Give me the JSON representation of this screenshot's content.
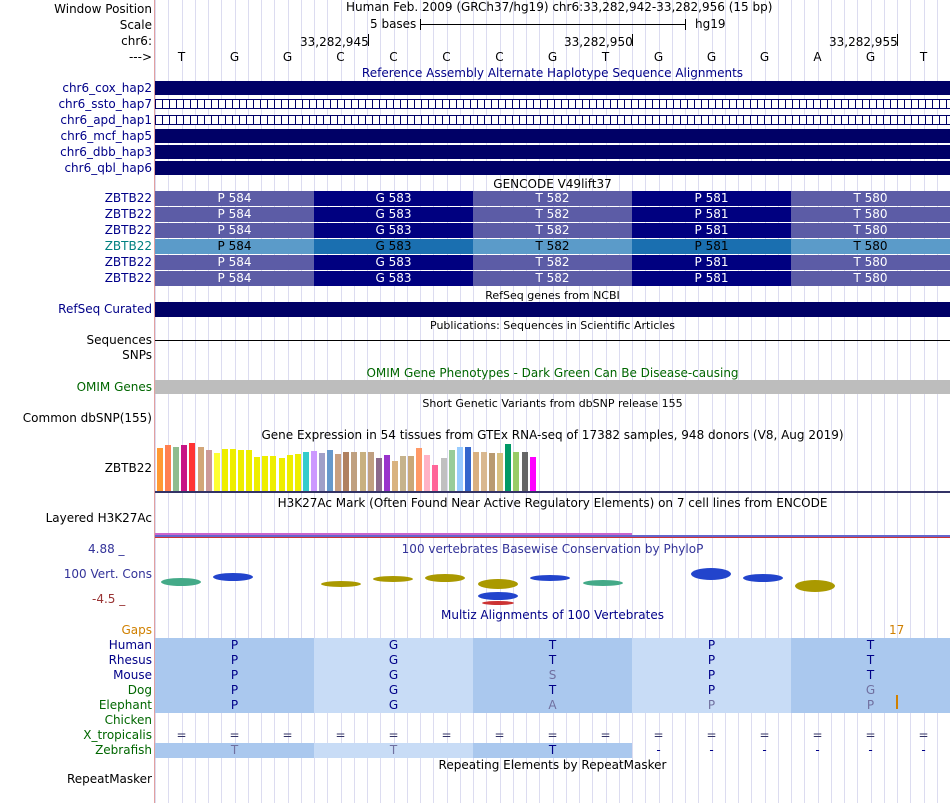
{
  "header": {
    "window_position_label": "Window Position",
    "scale_label": "Scale",
    "chrom_label": "chr6:",
    "arrow_label": "--->",
    "position_text": "Human Feb. 2009 (GRCh37/hg19)   chr6:33,282,942-33,282,956 (15 bp)",
    "scale_text": "5 bases",
    "assembly_text": "hg19",
    "coords": [
      "33,282,945",
      "33,282,950",
      "33,282,955"
    ],
    "bases": [
      "T",
      "G",
      "G",
      "C",
      "C",
      "C",
      "C",
      "G",
      "T",
      "G",
      "G",
      "G",
      "A",
      "G",
      "T"
    ]
  },
  "alt_haplotypes": {
    "title": "Reference Assembly Alternate Haplotype Sequence Alignments",
    "rows": [
      "chr6_cox_hap2",
      "chr6_ssto_hap7",
      "chr6_apd_hap1",
      "chr6_mcf_hap5",
      "chr6_dbb_hap3",
      "chr6_qbl_hap6"
    ]
  },
  "gencode": {
    "title": "GENCODE V49lift37",
    "gene": "ZBTB22",
    "codons": [
      "P 584",
      "G 583",
      "T 582",
      "P 581",
      "T 580"
    ]
  },
  "refseq": {
    "title": "RefSeq genes from NCBI",
    "label": "RefSeq Curated"
  },
  "publications": {
    "title": "Publications: Sequences in Scientific Articles",
    "label": "Sequences"
  },
  "snps": {
    "label": "SNPs"
  },
  "omim": {
    "title": "OMIM Gene Phenotypes - Dark Green Can Be Disease-causing",
    "label": "OMIM Genes"
  },
  "dbsnp": {
    "title": "Short Genetic Variants from dbSNP release 155",
    "label": "Common dbSNP(155)"
  },
  "gtex": {
    "title": "Gene Expression in 54 tissues from GTEx RNA-seq of 17382 samples, 948 donors (V8, Aug 2019)",
    "label": "ZBTB22",
    "bars": [
      {
        "c": "#ff9933",
        "h": 0.9
      },
      {
        "c": "#ff7f50",
        "h": 0.95
      },
      {
        "c": "#8fbc8f",
        "h": 0.92
      },
      {
        "c": "#c71585",
        "h": 0.95
      },
      {
        "c": "#ff3333",
        "h": 1.0
      },
      {
        "c": "#d2a679",
        "h": 0.92
      },
      {
        "c": "#cc9999",
        "h": 0.85
      },
      {
        "c": "#ffff33",
        "h": 0.8
      },
      {
        "c": "#eeee00",
        "h": 0.88
      },
      {
        "c": "#eeee00",
        "h": 0.88
      },
      {
        "c": "#eeee00",
        "h": 0.86
      },
      {
        "c": "#eeee00",
        "h": 0.85
      },
      {
        "c": "#eeee00",
        "h": 0.7
      },
      {
        "c": "#eeee00",
        "h": 0.72
      },
      {
        "c": "#eeee00",
        "h": 0.72
      },
      {
        "c": "#eeee00",
        "h": 0.68
      },
      {
        "c": "#eeee00",
        "h": 0.75
      },
      {
        "c": "#eeee00",
        "h": 0.78
      },
      {
        "c": "#33cccc",
        "h": 0.82
      },
      {
        "c": "#cc99ff",
        "h": 0.84
      },
      {
        "c": "#a0a0c8",
        "h": 0.8
      },
      {
        "c": "#6699cc",
        "h": 0.85
      },
      {
        "c": "#c8a080",
        "h": 0.78
      },
      {
        "c": "#b08060",
        "h": 0.82
      },
      {
        "c": "#bfa080",
        "h": 0.82
      },
      {
        "c": "#c8b080",
        "h": 0.82
      },
      {
        "c": "#c0a080",
        "h": 0.82
      },
      {
        "c": "#8b6a8b",
        "h": 0.68
      },
      {
        "c": "#9933cc",
        "h": 0.75
      },
      {
        "c": "#d9b380",
        "h": 0.62
      },
      {
        "c": "#c6b38c",
        "h": 0.72
      },
      {
        "c": "#c9a878",
        "h": 0.72
      },
      {
        "c": "#ff9966",
        "h": 0.9
      },
      {
        "c": "#ffb3c6",
        "h": 0.75
      },
      {
        "c": "#ff6699",
        "h": 0.55
      },
      {
        "c": "#c0c0c0",
        "h": 0.68
      },
      {
        "c": "#99cc99",
        "h": 0.85
      },
      {
        "c": "#99ccff",
        "h": 0.92
      },
      {
        "c": "#3366cc",
        "h": 0.92
      },
      {
        "c": "#d9b080",
        "h": 0.82
      },
      {
        "c": "#d9b890",
        "h": 0.82
      },
      {
        "c": "#b89a70",
        "h": 0.8
      },
      {
        "c": "#d8c080",
        "h": 0.8
      },
      {
        "c": "#009966",
        "h": 0.98
      },
      {
        "c": "#99cc66",
        "h": 0.82
      },
      {
        "c": "#666666",
        "h": 0.82
      },
      {
        "c": "#ff00ff",
        "h": 0.7
      }
    ]
  },
  "h3k27ac": {
    "title": "H3K27Ac Mark (Often Found Near Active Regulatory Elements) on 7 cell lines from ENCODE",
    "label": "Layered H3K27Ac"
  },
  "conservation": {
    "title": "100 vertebrates Basewise Conservation by PhyloP",
    "label": "100 Vert. Cons",
    "ymax": "4.88 _",
    "ymin": "-4.5 _"
  },
  "multiz": {
    "title": "Multiz Alignments of 100 Vertebrates",
    "gaps_label": "Gaps",
    "gaps_value": "17",
    "species": [
      {
        "name": "Human",
        "aa": [
          "P",
          "G",
          "T",
          "P",
          "T"
        ]
      },
      {
        "name": "Rhesus",
        "aa": [
          "P",
          "G",
          "T",
          "P",
          "T"
        ]
      },
      {
        "name": "Mouse",
        "aa": [
          "P",
          "G",
          "S",
          "P",
          "T"
        ]
      },
      {
        "name": "Dog",
        "aa": [
          "P",
          "G",
          "T",
          "P",
          "G"
        ]
      },
      {
        "name": "Elephant",
        "aa": [
          "P",
          "G",
          "A",
          "P",
          "P"
        ]
      },
      {
        "name": "Chicken",
        "aa": []
      },
      {
        "name": "X_tropicalis",
        "aa": []
      },
      {
        "name": "Zebrafish",
        "aa": [
          "T",
          "T",
          "T"
        ]
      }
    ],
    "equals": "=",
    "dash": "-"
  },
  "repeatmasker": {
    "title": "Repeating Elements by RepeatMasker",
    "label": "RepeatMasker"
  },
  "colors": {
    "navy": "#000066",
    "codon_light": "#5c5ca6",
    "codon_dark": "#000080",
    "sel_light": "#5b9bc9",
    "sel_dark": "#1a6fb0",
    "track_title": "#000088",
    "green_label": "#006600",
    "gaps_orange": "#d08000"
  }
}
